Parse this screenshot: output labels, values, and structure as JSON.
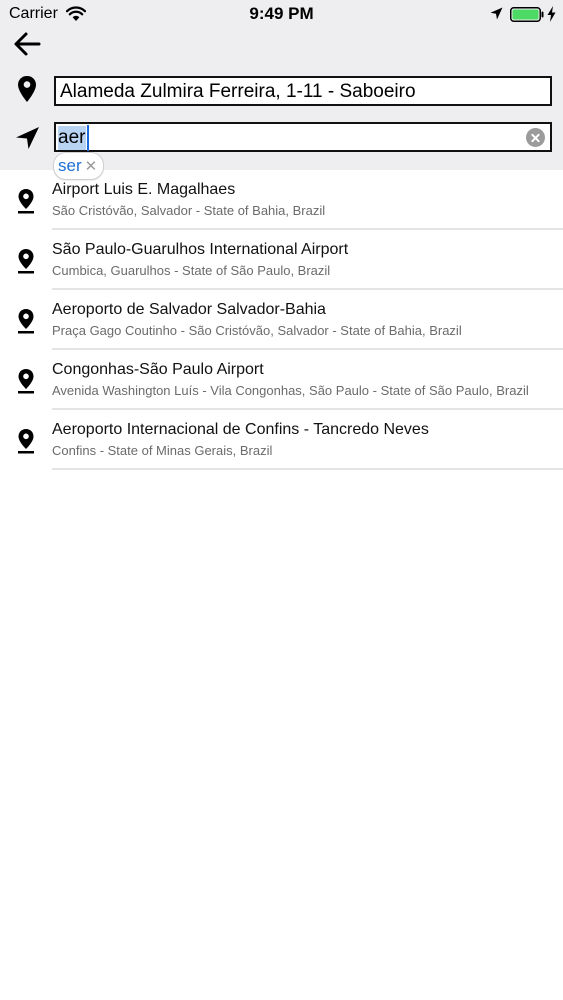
{
  "status_bar": {
    "carrier": "Carrier",
    "time": "9:49 PM",
    "battery_color": "#4cd964"
  },
  "header": {
    "background_color": "#eeeef0",
    "back_icon": "arrow-left-icon"
  },
  "origin": {
    "icon": "map-pin-icon",
    "value": "Alameda Zulmira Ferreira, 1-11 - Saboeiro"
  },
  "destination": {
    "icon": "navigation-arrow-icon",
    "value": "aer",
    "clear_icon": "clear-circle-icon"
  },
  "autocorrect_suggestion": {
    "word": "ser",
    "dismiss": "✕",
    "color": "#1e6fd6"
  },
  "results": [
    {
      "title": "Airport Luis E. Magalhaes",
      "subtitle": "São Cristóvão, Salvador - State of Bahia, Brazil"
    },
    {
      "title": "São Paulo-Guarulhos International Airport",
      "subtitle": "Cumbica, Guarulhos - State of São Paulo, Brazil"
    },
    {
      "title": "Aeroporto de Salvador Salvador-Bahia",
      "subtitle": "Praça Gago Coutinho - São Cristóvão, Salvador - State of Bahia, Brazil"
    },
    {
      "title": "Congonhas-São Paulo Airport",
      "subtitle": "Avenida Washington Luís - Vila Congonhas, São Paulo - State of São Paulo, Brazil"
    },
    {
      "title": "Aeroporto Internacional de Confins - Tancredo Neves",
      "subtitle": "Confins - State of Minas Gerais, Brazil"
    }
  ]
}
